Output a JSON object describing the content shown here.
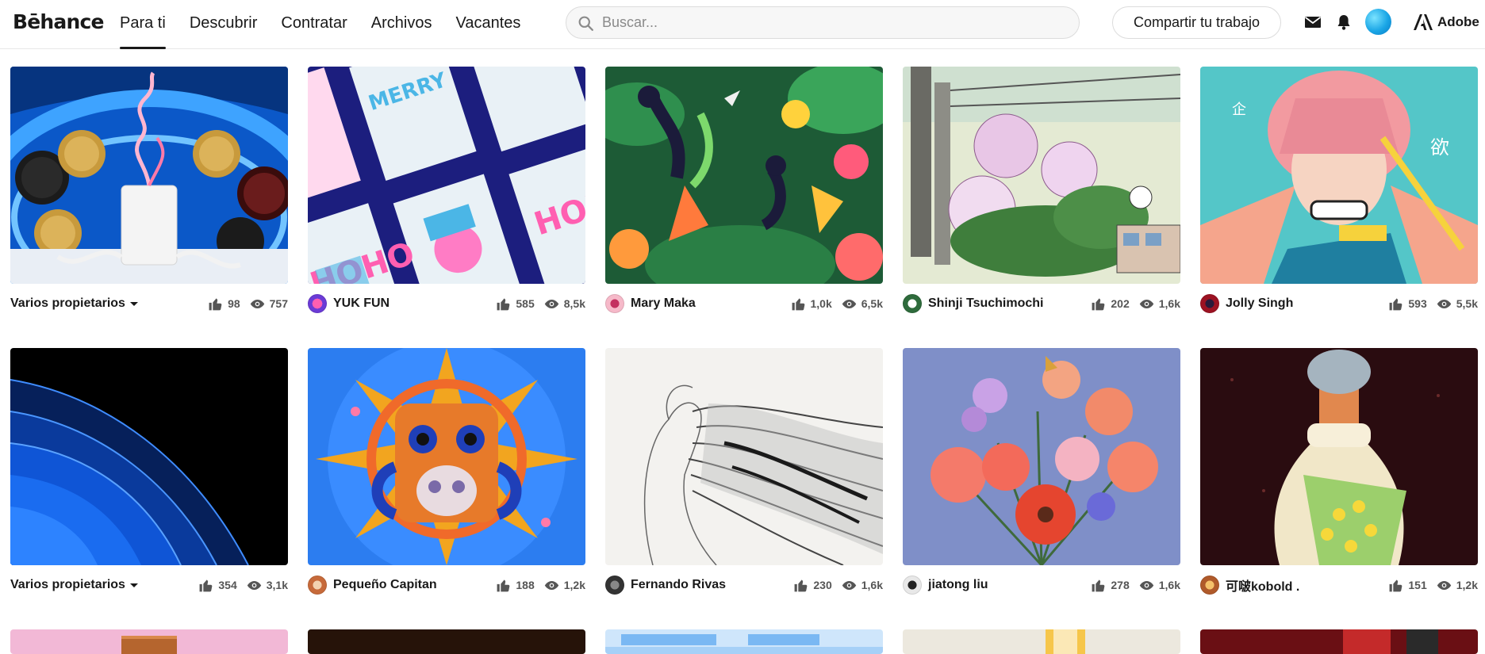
{
  "header": {
    "logo": "Bēhance",
    "nav": [
      {
        "label": "Para ti",
        "active": true
      },
      {
        "label": "Descubrir",
        "active": false
      },
      {
        "label": "Contratar",
        "active": false
      },
      {
        "label": "Archivos",
        "active": false
      },
      {
        "label": "Vacantes",
        "active": false
      }
    ],
    "search_placeholder": "Buscar...",
    "share_label": "Compartir tu trabajo",
    "adobe_label": "Adobe",
    "icons": [
      "search-icon",
      "mail-icon",
      "bell-icon",
      "adobe-icon"
    ]
  },
  "projects": [
    {
      "owner": "Varios propietarios",
      "multi": true,
      "likes": "98",
      "views": "757",
      "art": "oreo",
      "avatar_color": "#ffffff"
    },
    {
      "owner": "YUK FUN",
      "multi": false,
      "likes": "585",
      "views": "8,5k",
      "art": "cards",
      "avatar_color": "#ff5fb1"
    },
    {
      "owner": "Mary Maka",
      "multi": false,
      "likes": "1,0k",
      "views": "6,5k",
      "art": "jungle",
      "avatar_color": "#f07aa0"
    },
    {
      "owner": "Shinji Tsuchimochi",
      "multi": false,
      "likes": "202",
      "views": "1,6k",
      "art": "flowers-street",
      "avatar_color": "#2e6b3c"
    },
    {
      "owner": "Jolly Singh",
      "multi": false,
      "likes": "593",
      "views": "5,5k",
      "art": "anime",
      "avatar_color": "#9c1222"
    },
    {
      "owner": "Varios propietarios",
      "multi": true,
      "likes": "354",
      "views": "3,1k",
      "art": "blue-steps",
      "avatar_color": "#ffffff"
    },
    {
      "owner": "Pequeño Capitan",
      "multi": false,
      "likes": "188",
      "views": "1,2k",
      "art": "mask",
      "avatar_color": "#e7a86a"
    },
    {
      "owner": "Fernando Rivas",
      "multi": false,
      "likes": "230",
      "views": "1,6k",
      "art": "sketch",
      "avatar_color": "#333333"
    },
    {
      "owner": "jiatong liu",
      "multi": false,
      "likes": "278",
      "views": "1,6k",
      "art": "bouquet",
      "avatar_color": "#555555"
    },
    {
      "owner": "可啵kobold .",
      "multi": false,
      "likes": "151",
      "views": "1,2k",
      "art": "dress",
      "avatar_color": "#d47a3a"
    }
  ],
  "peek_row": [
    {
      "art": "pink"
    },
    {
      "art": "dark"
    },
    {
      "art": "light-blue"
    },
    {
      "art": "cream"
    },
    {
      "art": "red-dark"
    }
  ],
  "colors": {
    "text": "#191919",
    "muted": "#555555",
    "border": "#dcdcdc"
  }
}
